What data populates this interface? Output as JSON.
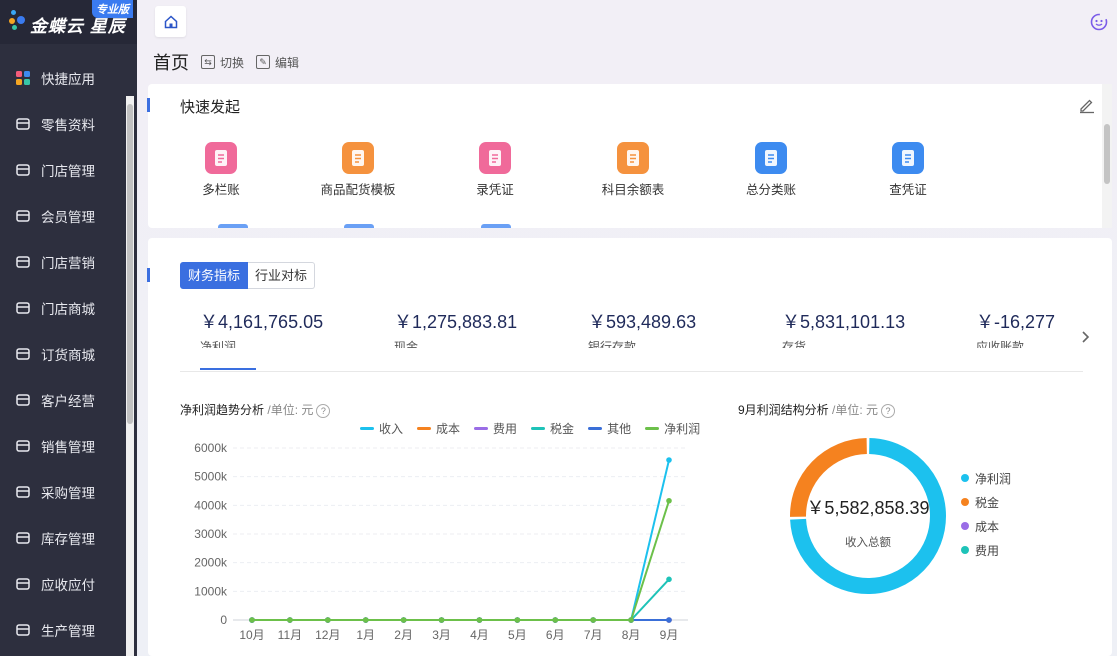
{
  "brand": {
    "name": "金蝶云 星辰",
    "badge": "专业版"
  },
  "sidebar": {
    "items": [
      {
        "label": "快捷应用",
        "icon": "apps-grid-icon"
      },
      {
        "label": "零售资料",
        "icon": "basket-icon"
      },
      {
        "label": "门店管理",
        "icon": "store-register-icon"
      },
      {
        "label": "会员管理",
        "icon": "member-diamond-icon"
      },
      {
        "label": "门店营销",
        "icon": "marketing-tag-icon"
      },
      {
        "label": "门店商城",
        "icon": "storefront-icon"
      },
      {
        "label": "订货商城",
        "icon": "shopping-bag-icon"
      },
      {
        "label": "客户经营",
        "icon": "customer-icon"
      },
      {
        "label": "销售管理",
        "icon": "sales-chart-icon"
      },
      {
        "label": "采购管理",
        "icon": "cart-icon"
      },
      {
        "label": "库存管理",
        "icon": "box-icon"
      },
      {
        "label": "应收应付",
        "icon": "receivable-icon"
      },
      {
        "label": "生产管理",
        "icon": "factory-icon"
      }
    ]
  },
  "page": {
    "title": "首页",
    "switch_label": "切换",
    "edit_label": "编辑"
  },
  "quick_start": {
    "title": "快速发起",
    "items": [
      {
        "label": "多栏账",
        "color": "#f06a9a"
      },
      {
        "label": "商品配货模板",
        "color": "#f5923e"
      },
      {
        "label": "录凭证",
        "color": "#f06a9a"
      },
      {
        "label": "科目余额表",
        "color": "#f5923e"
      },
      {
        "label": "总分类账",
        "color": "#3d8bf0"
      },
      {
        "label": "查凭证",
        "color": "#3d8bf0"
      }
    ]
  },
  "finance": {
    "tabs": [
      {
        "label": "财务指标"
      },
      {
        "label": "行业对标"
      }
    ],
    "kpis": [
      {
        "value": "￥4,161,765.05",
        "label": "净利润"
      },
      {
        "value": "￥1,275,883.81",
        "label": "现金"
      },
      {
        "value": "￥593,489.63",
        "label": "银行存款"
      },
      {
        "value": "￥5,831,101.13",
        "label": "存货"
      },
      {
        "value": "￥-16,277",
        "label": "应收账款"
      }
    ]
  },
  "trend": {
    "title": "净利润趋势分析",
    "unit": "/单位: 元"
  },
  "structure": {
    "title": "9月利润结构分析",
    "unit": "/单位: 元",
    "total_value": "￥5,582,858.39",
    "total_label": "收入总额"
  },
  "chart_data": [
    {
      "type": "line",
      "title": "净利润趋势分析",
      "categories": [
        "10月",
        "11月",
        "12月",
        "1月",
        "2月",
        "3月",
        "4月",
        "5月",
        "6月",
        "7月",
        "8月",
        "9月"
      ],
      "yticks": [
        "0",
        "1000k",
        "2000k",
        "3000k",
        "4000k",
        "5000k",
        "6000k"
      ],
      "ylim": [
        0,
        6000000
      ],
      "grid": true,
      "legend": "top",
      "series": [
        {
          "name": "收入",
          "color": "#1cc1ee",
          "values": [
            0,
            0,
            0,
            0,
            0,
            0,
            0,
            0,
            0,
            0,
            0,
            5580000
          ]
        },
        {
          "name": "成本",
          "color": "#f5821f",
          "values": [
            0,
            0,
            0,
            0,
            0,
            0,
            0,
            0,
            0,
            0,
            0,
            0
          ]
        },
        {
          "name": "费用",
          "color": "#9a6de6",
          "values": [
            0,
            0,
            0,
            0,
            0,
            0,
            0,
            0,
            0,
            0,
            0,
            0
          ]
        },
        {
          "name": "税金",
          "color": "#1ec3b8",
          "values": [
            0,
            0,
            0,
            0,
            0,
            0,
            0,
            0,
            0,
            0,
            0,
            1420000
          ]
        },
        {
          "name": "其他",
          "color": "#3a6fd8",
          "values": [
            0,
            0,
            0,
            0,
            0,
            0,
            0,
            0,
            0,
            0,
            0,
            0
          ]
        },
        {
          "name": "净利润",
          "color": "#6cc04a",
          "values": [
            0,
            0,
            0,
            0,
            0,
            0,
            0,
            0,
            0,
            0,
            0,
            4160000
          ]
        }
      ]
    },
    {
      "type": "pie",
      "title": "9月利润结构分析",
      "legend": "right",
      "slices": [
        {
          "name": "净利润",
          "color": "#1cc1ee",
          "value": 4161765.05
        },
        {
          "name": "税金",
          "color": "#f5821f",
          "value": 1421093.34
        },
        {
          "name": "成本",
          "color": "#9a6de6",
          "value": 0
        },
        {
          "name": "费用",
          "color": "#1ec3b8",
          "value": 0
        }
      ]
    }
  ]
}
